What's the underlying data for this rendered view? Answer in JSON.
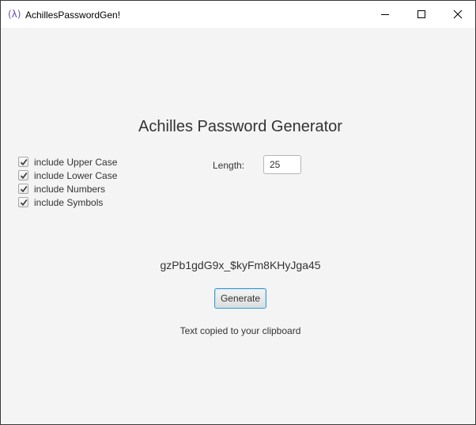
{
  "window": {
    "title": "AchillesPasswordGen!",
    "app_icon": "(λ)",
    "controls": {
      "minimize": "minimize-icon",
      "maximize": "maximize-icon",
      "close": "close-icon"
    }
  },
  "main": {
    "heading": "Achilles Password Generator",
    "options": [
      {
        "label": "include Upper Case",
        "checked": true
      },
      {
        "label": "include Lower Case",
        "checked": true
      },
      {
        "label": "include Numbers",
        "checked": true
      },
      {
        "label": "include Symbols",
        "checked": true
      }
    ],
    "length_label": "Length:",
    "length_value": "25",
    "password": "gzPb1gdG9x_$kyFm8KHyJga45",
    "generate_label": "Generate",
    "status": "Text copied to your clipboard"
  },
  "colors": {
    "background": "#f4f4f4",
    "focus_border": "#3d9ad1",
    "icon_accent": "#6a4fb0"
  }
}
